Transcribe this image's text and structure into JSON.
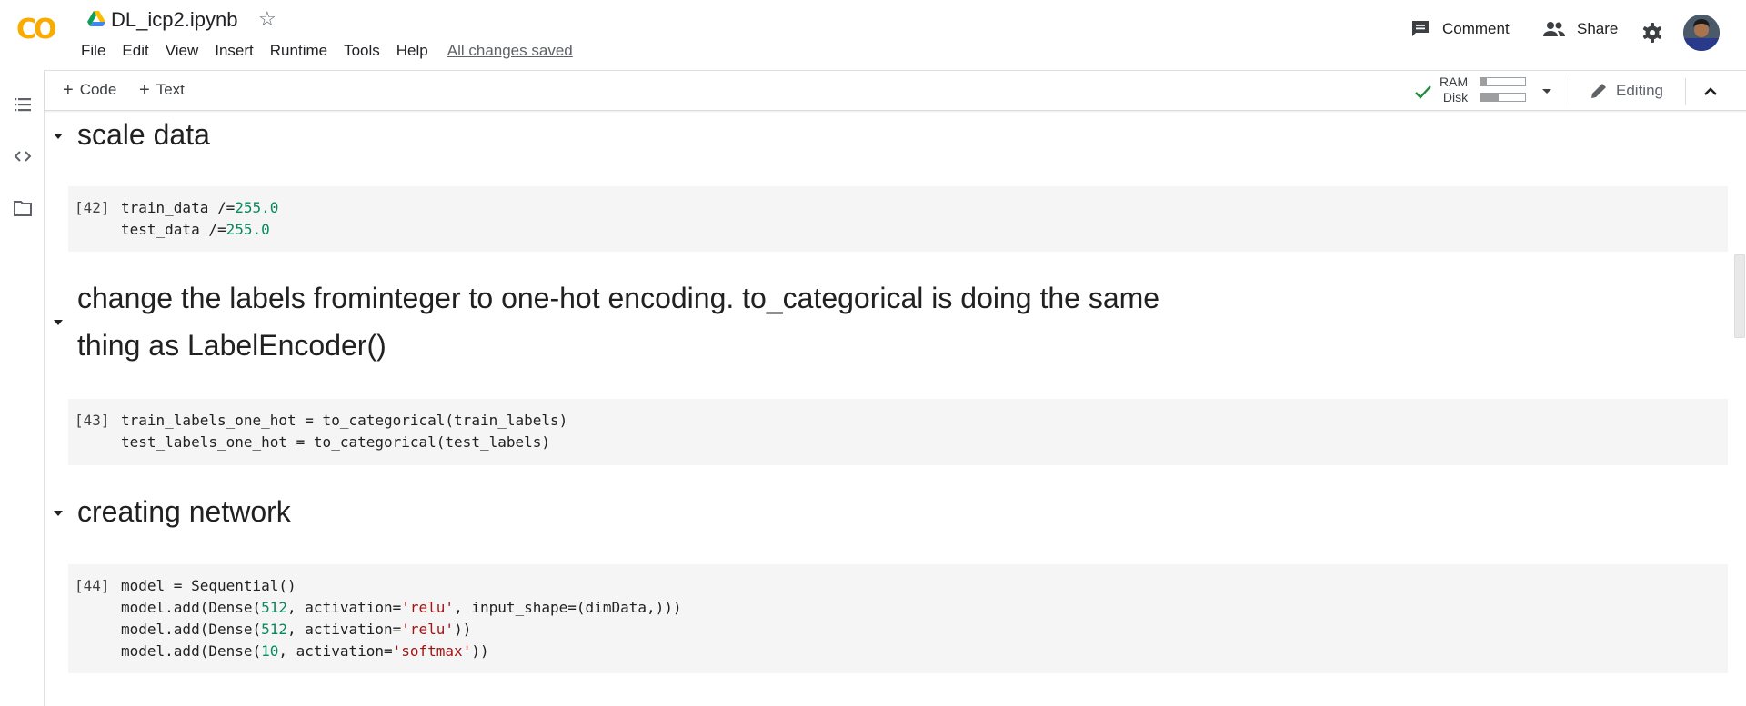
{
  "app": {
    "logo_text": "CO",
    "brand_color": "#f9ab00",
    "file_name": "DL_icp2.ipynb",
    "save_status": "All changes saved"
  },
  "menu": [
    "File",
    "Edit",
    "View",
    "Insert",
    "Runtime",
    "Tools",
    "Help"
  ],
  "header_actions": {
    "comment_label": "Comment",
    "share_label": "Share"
  },
  "sidebar": {
    "icons": [
      "table-of-contents-icon",
      "code-snippets-icon",
      "files-icon"
    ]
  },
  "toolbar": {
    "add_code_label": "Code",
    "add_text_label": "Text",
    "ram_label": "RAM",
    "disk_label": "Disk",
    "ram_usage": 0.15,
    "disk_usage": 0.4,
    "connected_color": "#1e8e3e",
    "editing_label": "Editing"
  },
  "cells": [
    {
      "type": "markdown",
      "heading": "scale data"
    },
    {
      "type": "code",
      "exec_count": "[42]",
      "lines": [
        "train_data /=255.0",
        "test_data /=255.0"
      ]
    },
    {
      "type": "markdown",
      "heading_line1": "change the labels frominteger to one-hot encoding. to_categorical is doing the same",
      "heading_line2": "thing as LabelEncoder()"
    },
    {
      "type": "code",
      "exec_count": "[43]",
      "lines": [
        "train_labels_one_hot = to_categorical(train_labels)",
        "test_labels_one_hot = to_categorical(test_labels)"
      ]
    },
    {
      "type": "markdown",
      "heading": "creating network"
    },
    {
      "type": "code",
      "exec_count": "[44]",
      "lines": [
        "model = Sequential()",
        "model.add(Dense(512, activation='relu', input_shape=(dimData,)))",
        "model.add(Dense(512, activation='relu'))",
        "model.add(Dense(10, activation='softmax'))"
      ]
    }
  ]
}
